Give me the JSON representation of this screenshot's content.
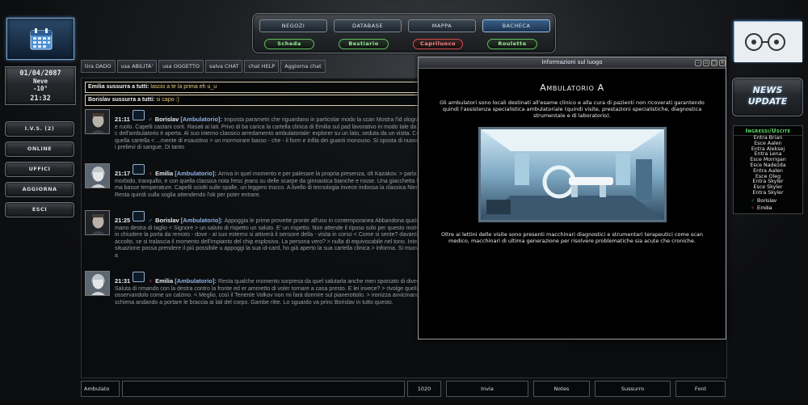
{
  "datetime": {
    "date": "01/04/2087",
    "weather": "Neve",
    "temp": "-10°",
    "time": "21:32"
  },
  "left_menu": [
    "I.V.S. (2)",
    "ONLINE",
    "UFFICI",
    "AGGIORNA",
    "ESCI"
  ],
  "nav": {
    "top": [
      "NEGOZI",
      "DATABASE",
      "MAPPA",
      "BACHECA"
    ],
    "bottom": [
      "Scheda",
      "Bestiario",
      "Capriluoco",
      "Roulette"
    ]
  },
  "tools": [
    "tira DADO",
    "usa ABILITA'",
    "usa OGGETTO",
    "salva CHAT",
    "chat HELP",
    "Aggiorna chat"
  ],
  "whispers": [
    {
      "who": "Emilia sussurra a tutti:",
      "text": "lascio a te la prima eh u_u"
    },
    {
      "who": "Borislav sussurra a tutti:",
      "text": "si capo :)"
    }
  ],
  "messages": [
    {
      "time": "21:11",
      "gender": "♂",
      "name": "Borislav",
      "location": "[Ambulatorio]:",
      "text": "Imposta parametri che riguardano in particolar modo la scan Mostra l'id olografico in 2d con nominativo, grado e ruolo. Capelli castani corti. Rasati ai lati. Privo di ba carica la cartella clinica di Emilia sul pad lavorativo in modo tale da poter valutare gli ulteriori passi - c dell'ambulatorio è aperta. Al suo interno classico arredamento ambulatoriale: explorer su un lato, seduta da un visita. Corruga la fronte leggendo i dati di quella cartella < ...mente di esaustivo > un mormorare basso - che - il form e infila dei guanti monouso. Si sposta di nuovo. Prepara la strumentazione per i prelievi di sangue. Di tanto"
    },
    {
      "time": "21:17",
      "gender": "♀",
      "name": "Emilia",
      "location": "[Ambulatorio]:",
      "text": "Arriva in quel momento e per palesare la propria presenza, olt Kazakov. > parla in lingua internazionale. Il tono è morbido, tranquillo, e con quella classica nota fresc jeans su delle scarpe da ginnastica bianche e rosse. Una giacchetta felpata nera con al di sotto una ma basse temperature. Capelli sciolti sulle spalle, un leggero trucco. A livello di tecnologia invece indossa la classica Niente borse, niente oggettistica. Resta quindi sulla soglia attendendo l'ok per poter entrare."
    },
    {
      "time": "21:25",
      "gender": "♂",
      "name": "Borislav",
      "location": "[Ambulatorio]:",
      "text": "Appoggia le prime provette pronte all'uso in contemporanea Abbandona qualsiasi cosa stia facendo. Porta la mano destra di taglio < Signore > un saluto di rispetto un saluto. E' un rispetto. Non attende il riposo solo per questo motivo. Le labbra si piegano appena in chiudere la porta da remoto - dove - al suo esterno si attiverà il sensore della - visita in corso < Come si sente? davanti a se la persona che lo ha accolto, se si tralascia il momento dell'impianto del chip esplosivo. La persona vero? > nulla di equivocabile nel tono. Interessato a far sì che la sua situazione possa prendere il più possibile u appoggi la sua id-card, ho già aperto la sua cartella clinica > informa. Si muove verso lo strumento medico. Lo a"
    },
    {
      "time": "21:31",
      "gender": "♀",
      "name": "Emilia",
      "location": "[Ambulatorio]:",
      "text": "Resta qualche momento sorpresa da quel salutarla anche men sporcato di divertimento e compiacenza in bene. Saluta di rimando con la destra contro la fronte ed er ammetto di voler tornare a casa presto. E lei invece? > rivolge quella domanda all'uomo osservandolo come un calzino. < Meglio, così il Tenente Volkov non mi farà dormire sul pianerottolo. > ironizza avvicinandosi distende con calma sulla schiena andando a portare le braccia ai lati del corpo. Gambe ritte. Lo sguardo va princ Borislav in tutto questo."
    }
  ],
  "modal": {
    "bar_title": "Informazioni sul luogo",
    "title": "Ambulatorio A",
    "p1": "Gli ambulatori sono locali destinati all'esame clinico e alla cura di pazienti non ricoverati garantendo quindi l'assistenza specialistica ambulatoriale (quindi visite, prestazioni specialistiche, diagnostica strumentale e di laboratorio).",
    "p2": "Oltre ai lettini delle visite sono presenti macchinari diagnostici e strumentari terapeutici come scan medico, macchinari di ultima generazione per risolvere problematiche sia acute che croniche."
  },
  "news": {
    "line1": "NEWS",
    "line2": "UPDATE"
  },
  "ingressi": {
    "title": "Ingressi/Uscite",
    "events": [
      "Entra Brian",
      "Esce Aalen",
      "Entra Aleksej",
      "Entra Lena",
      "Esce Morrigan",
      "Esce Nadezda",
      "Entra Aalen",
      "Esce Oleg",
      "Entra Skyler",
      "Esce Skyler",
      "Entra Skyler"
    ]
  },
  "online": [
    {
      "gender": "♂",
      "name": "Borislav"
    },
    {
      "gender": "♀",
      "name": "Emilia"
    }
  ],
  "bottom": {
    "location_value": "Ambulato",
    "counter": "1020",
    "send": "Invia",
    "notes": "Notes",
    "whisper": "Sussurro",
    "font": "Font"
  },
  "colors": {
    "accent_blue": "#7fa6c9",
    "pill_green": "#5cbf5c",
    "pill_red": "#d24a4a",
    "ingressi_green": "#5fe16b"
  }
}
